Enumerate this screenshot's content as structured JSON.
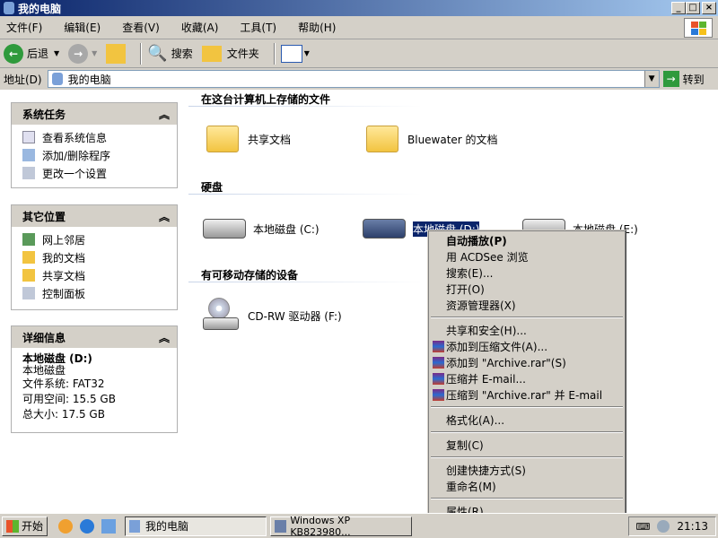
{
  "window": {
    "title": "我的电脑",
    "buttons": [
      "_",
      "□",
      "×"
    ]
  },
  "menu": [
    "文件(F)",
    "编辑(E)",
    "查看(V)",
    "收藏(A)",
    "工具(T)",
    "帮助(H)"
  ],
  "toolbar": {
    "back": "后退",
    "search": "搜索",
    "folders": "文件夹"
  },
  "address": {
    "label": "地址(D)",
    "value": "我的电脑",
    "go": "转到"
  },
  "sidebar": {
    "system_tasks": {
      "title": "系统任务",
      "items": [
        "查看系统信息",
        "添加/删除程序",
        "更改一个设置"
      ]
    },
    "other_places": {
      "title": "其它位置",
      "items": [
        "网上邻居",
        "我的文档",
        "共享文档",
        "控制面板"
      ]
    },
    "details": {
      "title": "详细信息",
      "name": "本地磁盘 (D:)",
      "type": "本地磁盘",
      "fs": "文件系统: FAT32",
      "free": "可用空间: 15.5 GB",
      "total": "总大小: 17.5 GB"
    }
  },
  "main": {
    "section_files": "在这台计算机上存储的文件",
    "files": [
      "共享文档",
      "Bluewater 的文档"
    ],
    "section_disks": "硬盘",
    "disks": [
      "本地磁盘 (C:)",
      "本地磁盘 (D:)",
      "本地磁盘 (E:)"
    ],
    "section_removable": "有可移动存储的设备",
    "removable": [
      "CD-RW 驱动器 (F:)"
    ]
  },
  "context_menu": {
    "group1": [
      "自动播放(P)",
      "用 ACDSee 浏览",
      "搜索(E)...",
      "打开(O)",
      "资源管理器(X)"
    ],
    "group2": [
      "共享和安全(H)...",
      "添加到压缩文件(A)...",
      "添加到 \"Archive.rar\"(S)",
      "压缩并 E-mail...",
      "压缩到 \"Archive.rar\" 并 E-mail"
    ],
    "group3": [
      "格式化(A)..."
    ],
    "group4": [
      "复制(C)"
    ],
    "group5": [
      "创建快捷方式(S)",
      "重命名(M)"
    ],
    "group6": [
      "属性(R)"
    ]
  },
  "taskbar": {
    "start": "开始",
    "tasks": [
      "我的电脑",
      "Windows XP KB823980..."
    ],
    "clock": "21:13"
  }
}
